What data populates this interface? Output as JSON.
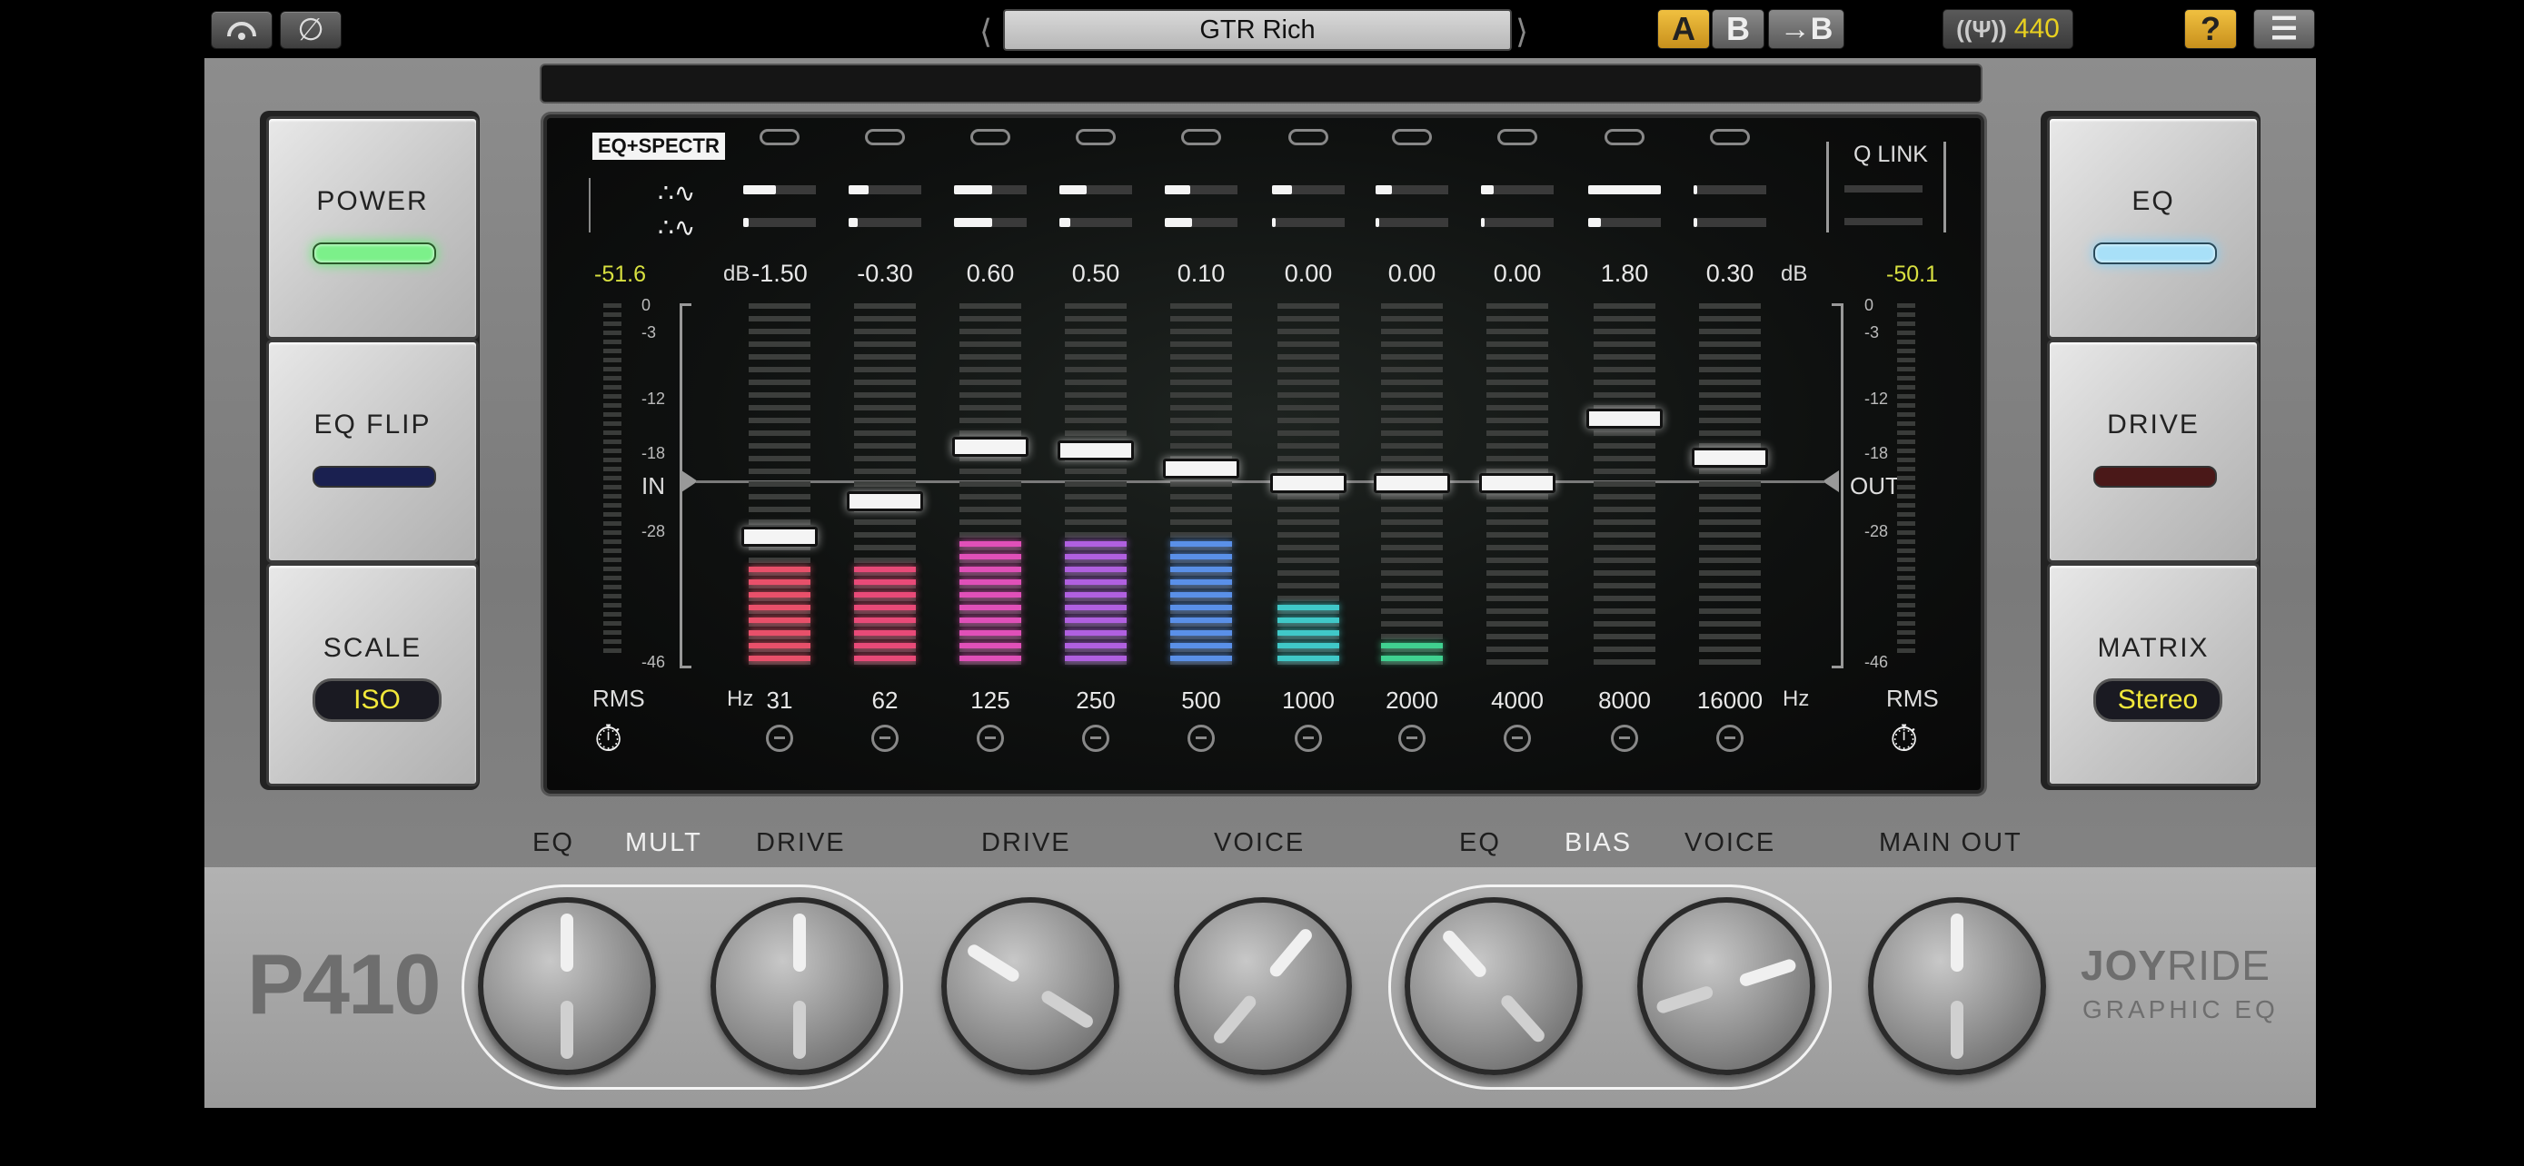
{
  "toolbar": {
    "preset_name": "GTR Rich",
    "ab_a": "A",
    "ab_b": "B",
    "ab_copy": "→B",
    "tuning_value": "440",
    "help": "?",
    "menu": "☰"
  },
  "left_buttons": {
    "power": "POWER",
    "eq_flip": "EQ FLIP",
    "scale": "SCALE",
    "scale_value": "ISO"
  },
  "right_buttons": {
    "eq": "EQ",
    "drive": "DRIVE",
    "matrix": "MATRIX",
    "matrix_value": "Stereo"
  },
  "screen": {
    "mode_badge": "EQ+SPECTR",
    "q_link": "Q LINK",
    "db_unit": "dB",
    "hz_unit": "Hz",
    "in_label": "IN",
    "out_label": "OUT",
    "rms_left": "RMS",
    "rms_right": "RMS",
    "in_peak": "-51.6",
    "out_peak": "-50.1",
    "scale_ticks": [
      "0",
      "-3",
      "-12",
      "-18",
      "-28",
      "-46"
    ],
    "bands": [
      {
        "hz": "31",
        "gain": "-1.50",
        "fader": 0.35,
        "level": 0.28,
        "color": "#e8506a"
      },
      {
        "hz": "62",
        "gain": "-0.30",
        "fader": 0.45,
        "level": 0.28,
        "color": "#e84a78"
      },
      {
        "hz": "125",
        "gain": "0.60",
        "fader": 0.6,
        "level": 0.34,
        "color": "#e050b8"
      },
      {
        "hz": "250",
        "gain": "0.50",
        "fader": 0.59,
        "level": 0.34,
        "color": "#b060e0"
      },
      {
        "hz": "500",
        "gain": "0.10",
        "fader": 0.54,
        "level": 0.34,
        "color": "#5a90e8"
      },
      {
        "hz": "1000",
        "gain": "0.00",
        "fader": 0.5,
        "level": 0.18,
        "color": "#40c8c8"
      },
      {
        "hz": "2000",
        "gain": "0.00",
        "fader": 0.5,
        "level": 0.06,
        "color": "#40d090"
      },
      {
        "hz": "4000",
        "gain": "0.00",
        "fader": 0.5,
        "level": 0.0,
        "color": "#40d090"
      },
      {
        "hz": "8000",
        "gain": "1.80",
        "fader": 0.68,
        "level": 0.0,
        "color": "#40d090"
      },
      {
        "hz": "16000",
        "gain": "0.30",
        "fader": 0.57,
        "level": 0.0,
        "color": "#40d090"
      }
    ]
  },
  "knobs": {
    "group1": {
      "eq": "EQ",
      "mult": "MULT",
      "drive": "DRIVE"
    },
    "drive": "DRIVE",
    "voice": "VOICE",
    "group2": {
      "eq": "EQ",
      "bias": "BIAS",
      "voice": "VOICE"
    },
    "main_out": "MAIN OUT"
  },
  "branding": {
    "model": "P410",
    "brand_joy": "JOY",
    "brand_ride": "RIDE",
    "subtitle": "GRAPHIC EQ"
  }
}
